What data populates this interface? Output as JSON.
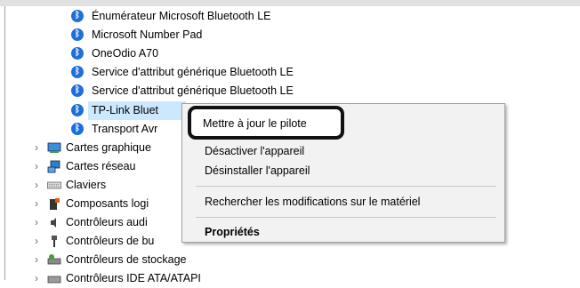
{
  "tree": {
    "bluetooth_items": [
      {
        "label": "Énumérateur Microsoft Bluetooth LE"
      },
      {
        "label": "Microsoft Number Pad"
      },
      {
        "label": "OneOdio A70"
      },
      {
        "label": "Service d'attribut générique Bluetooth LE"
      },
      {
        "label": "Service d'attribut générique Bluetooth LE"
      },
      {
        "label": "TP-Link Bluet"
      },
      {
        "label": "Transport Avr"
      }
    ],
    "categories": [
      {
        "label": "Cartes graphique",
        "icon": "display-adapter-icon"
      },
      {
        "label": "Cartes réseau",
        "icon": "network-adapter-icon"
      },
      {
        "label": "Claviers",
        "icon": "keyboard-icon"
      },
      {
        "label": "Composants logi",
        "icon": "software-component-icon"
      },
      {
        "label": "Contrôleurs audi",
        "icon": "audio-controller-icon"
      },
      {
        "label": "Contrôleurs de bu",
        "icon": "usb-controller-icon"
      },
      {
        "label": "Contrôleurs de stockage",
        "icon": "storage-controller-icon"
      },
      {
        "label": "Contrôleurs IDE ATA/ATAPI",
        "icon": "ide-controller-icon"
      }
    ]
  },
  "context_menu": {
    "update_driver": "Mettre à jour le pilote",
    "disable_device": "Désactiver l'appareil",
    "uninstall_device": "Désinstaller l'appareil",
    "scan_hardware": "Rechercher les modifications sur le matériel",
    "properties": "Propriétés"
  }
}
